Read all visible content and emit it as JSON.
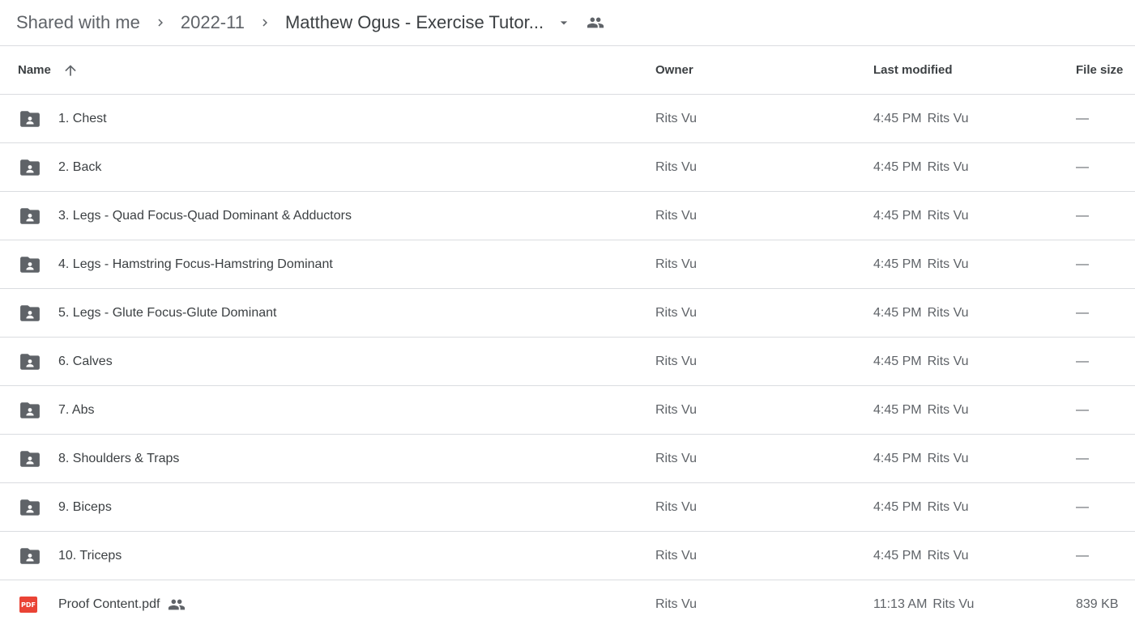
{
  "breadcrumb": {
    "items": [
      "Shared with me",
      "2022-11"
    ],
    "current": "Matthew Ogus - Exercise Tutor...",
    "current_dropdown_icon": "arrow-drop-down-icon",
    "shared_icon": "people-icon"
  },
  "table": {
    "headers": {
      "name": "Name",
      "owner": "Owner",
      "last_modified": "Last modified",
      "file_size": "File size"
    },
    "sort": "ascending",
    "rows": [
      {
        "type": "shared-folder",
        "name": "1. Chest",
        "owner": "Rits Vu",
        "modified_time": "4:45 PM",
        "modified_by": "Rits Vu",
        "size": "—"
      },
      {
        "type": "shared-folder",
        "name": "2. Back",
        "owner": "Rits Vu",
        "modified_time": "4:45 PM",
        "modified_by": "Rits Vu",
        "size": "—"
      },
      {
        "type": "shared-folder",
        "name": "3. Legs - Quad Focus-Quad Dominant & Adductors",
        "owner": "Rits Vu",
        "modified_time": "4:45 PM",
        "modified_by": "Rits Vu",
        "size": "—"
      },
      {
        "type": "shared-folder",
        "name": "4. Legs - Hamstring Focus-Hamstring Dominant",
        "owner": "Rits Vu",
        "modified_time": "4:45 PM",
        "modified_by": "Rits Vu",
        "size": "—"
      },
      {
        "type": "shared-folder",
        "name": "5. Legs - Glute Focus-Glute Dominant",
        "owner": "Rits Vu",
        "modified_time": "4:45 PM",
        "modified_by": "Rits Vu",
        "size": "—"
      },
      {
        "type": "shared-folder",
        "name": "6. Calves",
        "owner": "Rits Vu",
        "modified_time": "4:45 PM",
        "modified_by": "Rits Vu",
        "size": "—"
      },
      {
        "type": "shared-folder",
        "name": "7. Abs",
        "owner": "Rits Vu",
        "modified_time": "4:45 PM",
        "modified_by": "Rits Vu",
        "size": "—"
      },
      {
        "type": "shared-folder",
        "name": "8. Shoulders & Traps",
        "owner": "Rits Vu",
        "modified_time": "4:45 PM",
        "modified_by": "Rits Vu",
        "size": "—"
      },
      {
        "type": "shared-folder",
        "name": "9. Biceps",
        "owner": "Rits Vu",
        "modified_time": "4:45 PM",
        "modified_by": "Rits Vu",
        "size": "—"
      },
      {
        "type": "shared-folder",
        "name": "10. Triceps",
        "owner": "Rits Vu",
        "modified_time": "4:45 PM",
        "modified_by": "Rits Vu",
        "size": "—"
      },
      {
        "type": "pdf",
        "name": "Proof Content.pdf",
        "shared": true,
        "owner": "Rits Vu",
        "modified_time": "11:13 AM",
        "modified_by": "Rits Vu",
        "size": "839 KB",
        "icon_label": "PDF"
      }
    ]
  },
  "colors": {
    "text_primary": "#3c4043",
    "text_secondary": "#5f6368",
    "divider": "#dadce0",
    "pdf_red": "#ea4335"
  }
}
